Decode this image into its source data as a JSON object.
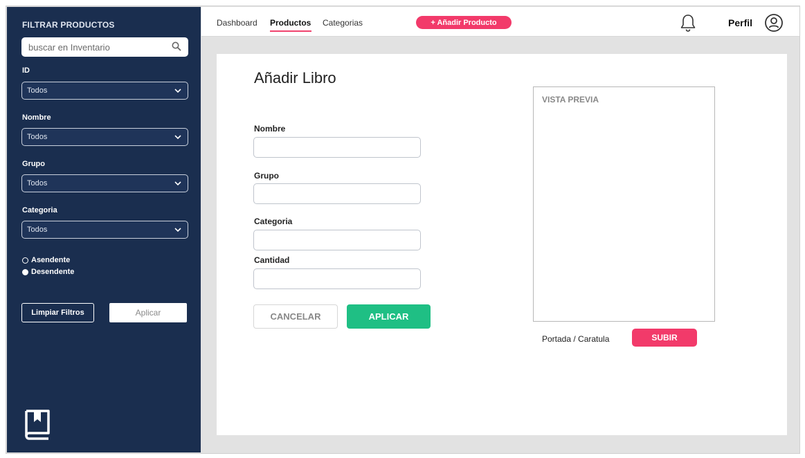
{
  "sidebar": {
    "title": "FILTRAR PRODUCTOS",
    "search_placeholder": "buscar en Inventario",
    "filters": [
      {
        "label": "ID",
        "value": "Todos"
      },
      {
        "label": "Nombre",
        "value": "Todos"
      },
      {
        "label": "Grupo",
        "value": "Todos"
      },
      {
        "label": "Categoria",
        "value": "Todos"
      }
    ],
    "sort": {
      "asc_label": "Asendente",
      "desc_label": "Desendente",
      "selected": "Desendente"
    },
    "clear_label": "Limpiar Filtros",
    "apply_label": "Aplicar",
    "logo_icon": "book-bookmark-icon"
  },
  "topnav": {
    "links": [
      "Dashboard",
      "Productos",
      "Categorias"
    ],
    "active": "Productos",
    "add_button": "+ Añadir Producto",
    "bell_icon": "bell-icon",
    "profile_label": "Perfil",
    "avatar_icon": "user-circle-icon"
  },
  "form": {
    "title": "Añadir Libro",
    "fields": [
      {
        "label": "Nombre",
        "value": ""
      },
      {
        "label": "Grupo",
        "value": ""
      },
      {
        "label": "Categoria",
        "value": ""
      },
      {
        "label": "Cantidad",
        "value": ""
      }
    ],
    "cancel_label": "CANCELAR",
    "apply_label": "APLICAR",
    "preview_label": "VISTA PREVIA",
    "cover_label": "Portada / Caratula",
    "upload_label": "SUBIR"
  },
  "colors": {
    "sidebar": "#1a2e4f",
    "accent_pink": "#f23a6a",
    "accent_green": "#1fbf84"
  }
}
